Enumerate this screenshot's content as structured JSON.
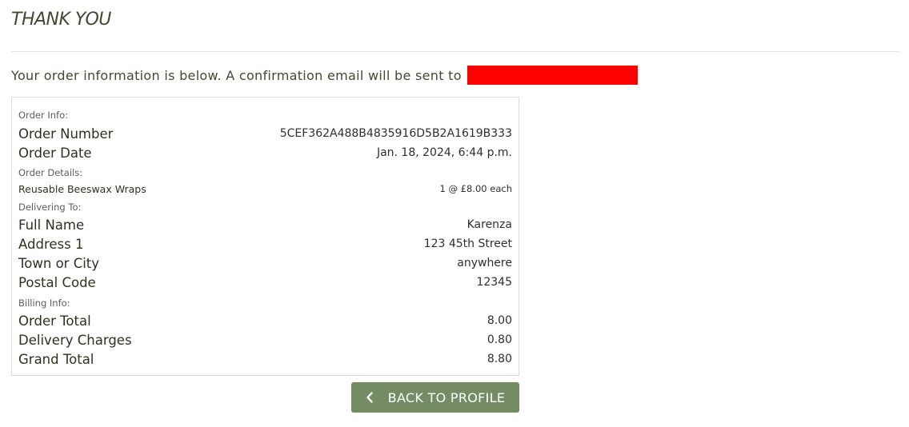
{
  "page": {
    "title": "THANK YOU",
    "intro_text": "Your order information is below. A confirmation email will be sent to"
  },
  "order": {
    "order_info_label": "Order Info:",
    "order_number_label": "Order Number",
    "order_number": "5CEF362A488B4835916D5B2A1619B333",
    "order_date_label": "Order Date",
    "order_date": "Jan. 18, 2024, 6:44 p.m.",
    "order_details_label": "Order Details:",
    "items": [
      {
        "name": "Reusable Beeswax Wraps",
        "quantity_price": "1 @ £8.00 each"
      }
    ],
    "delivering_label": "Delivering To:",
    "full_name_label": "Full Name",
    "full_name": "Karenza",
    "address1_label": "Address 1",
    "address1": "123 45th Street",
    "town_label": "Town or City",
    "town": "anywhere",
    "postal_label": "Postal Code",
    "postal_code": "12345",
    "billing_label": "Billing Info:",
    "order_total_label": "Order Total",
    "order_total": "8.00",
    "delivery_label": "Delivery Charges",
    "delivery_charges": "0.80",
    "grand_total_label": "Grand Total",
    "grand_total": "8.80"
  },
  "actions": {
    "back_label": "BACK TO PROFILE"
  },
  "icons": {
    "back": "chevron-left-icon"
  },
  "colors": {
    "button_bg": "#748b63",
    "text": "#3f4a32",
    "redaction": "#ff0000"
  }
}
